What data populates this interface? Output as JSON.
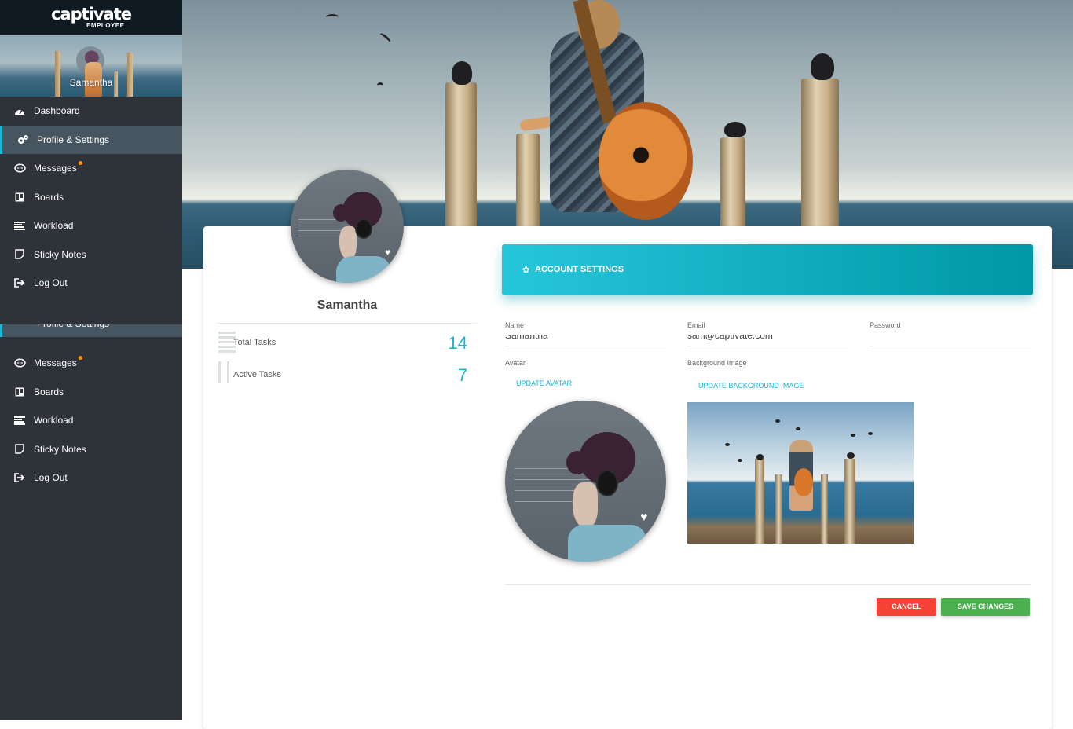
{
  "app": {
    "logo_text": "captivate",
    "logo_sub": "EMPLOYEE"
  },
  "user": {
    "name": "Samantha"
  },
  "nav": {
    "items": [
      {
        "label": "Dashboard",
        "icon": "dashboard-icon"
      },
      {
        "label": "Profile & Settings",
        "icon": "gears-icon",
        "active": true
      },
      {
        "label": "Messages",
        "icon": "chat-icon",
        "badge_color": "#ff9800"
      },
      {
        "label": "Boards",
        "icon": "board-icon"
      },
      {
        "label": "Workload",
        "icon": "list-icon"
      },
      {
        "label": "Sticky Notes",
        "icon": "note-icon"
      },
      {
        "label": "Log Out",
        "icon": "logout-icon"
      }
    ],
    "duplicate_items": [
      {
        "label": "Messages",
        "icon": "chat-icon"
      },
      {
        "label": "Boards",
        "icon": "board-icon"
      },
      {
        "label": "Workload",
        "icon": "list-icon"
      },
      {
        "label": "Sticky Notes",
        "icon": "note-icon"
      },
      {
        "label": "Log Out",
        "icon": "logout-icon"
      }
    ]
  },
  "stats": [
    {
      "label": "Total Tasks",
      "value": "14"
    },
    {
      "label": "Active Tasks",
      "value": "7"
    }
  ],
  "account": {
    "title": "ACCOUNT SETTINGS",
    "name_label": "Name",
    "name_value": "Samantha",
    "email_label": "Email",
    "email_value": "sam@captivate.com",
    "password_label": "Password",
    "password_value": "",
    "avatar_label": "Avatar",
    "update_avatar": "UPDATE AVATAR",
    "bg_label": "Background Image",
    "update_bg": "UPDATE BACKGROUND IMAGE",
    "cancel": "CANCEL",
    "save": "SAVE CHANGES"
  },
  "colors": {
    "accent": "#1fb4d2",
    "sidebar": "#2d3339",
    "cancel": "#f44336",
    "save": "#4caf50",
    "badge": "#ff9800"
  }
}
